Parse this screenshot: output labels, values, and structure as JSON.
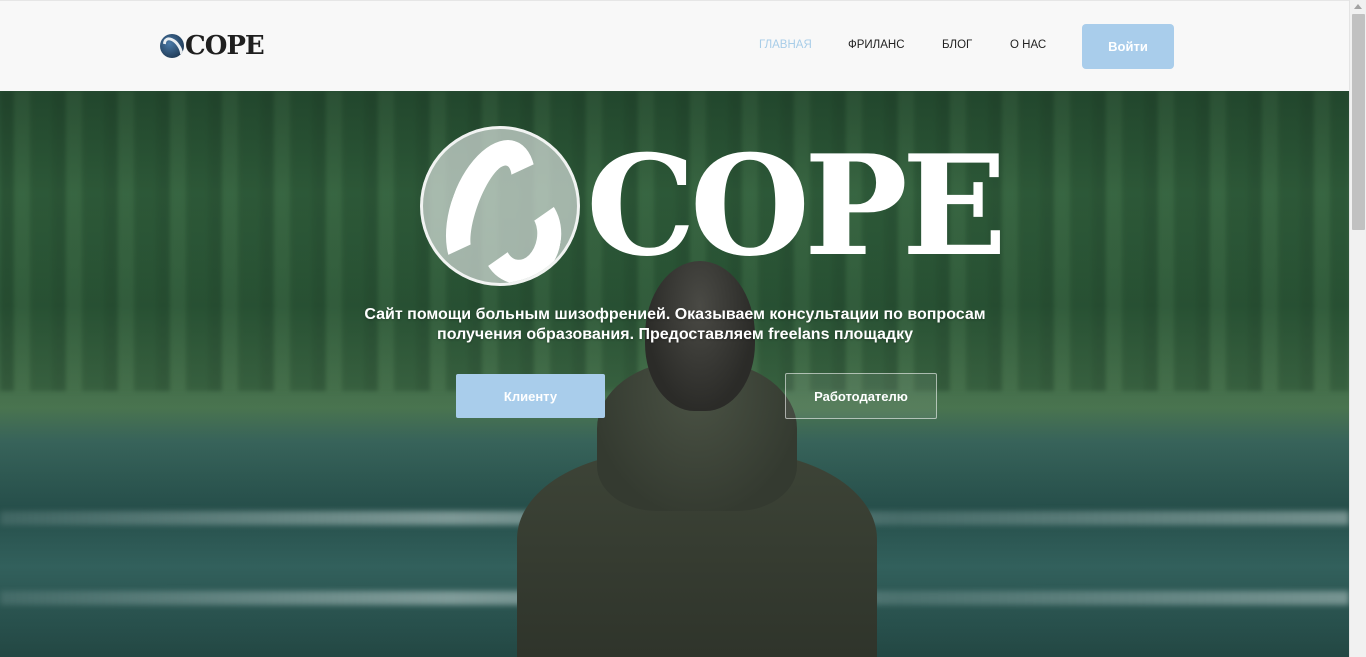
{
  "header": {
    "logo_text": "COPE",
    "nav": [
      {
        "label": "ГЛАВНАЯ",
        "active": true
      },
      {
        "label": "ФРИЛАНС",
        "active": false
      },
      {
        "label": "БЛОГ",
        "active": false
      },
      {
        "label": "О НАС",
        "active": false
      }
    ],
    "login_label": "Войти"
  },
  "hero": {
    "logo_text": "COPE",
    "tagline_line1": "Сайт помощи больным шизофренией. Оказываем консультации по вопросам",
    "tagline_line2": "получения образования. Предоставляем freelans площадку",
    "client_button": "Клиенту",
    "employer_button": "Работодателю"
  },
  "colors": {
    "accent": "#a9cdeb",
    "nav_active": "#a8cde8",
    "header_bg": "#f8f8f8"
  }
}
